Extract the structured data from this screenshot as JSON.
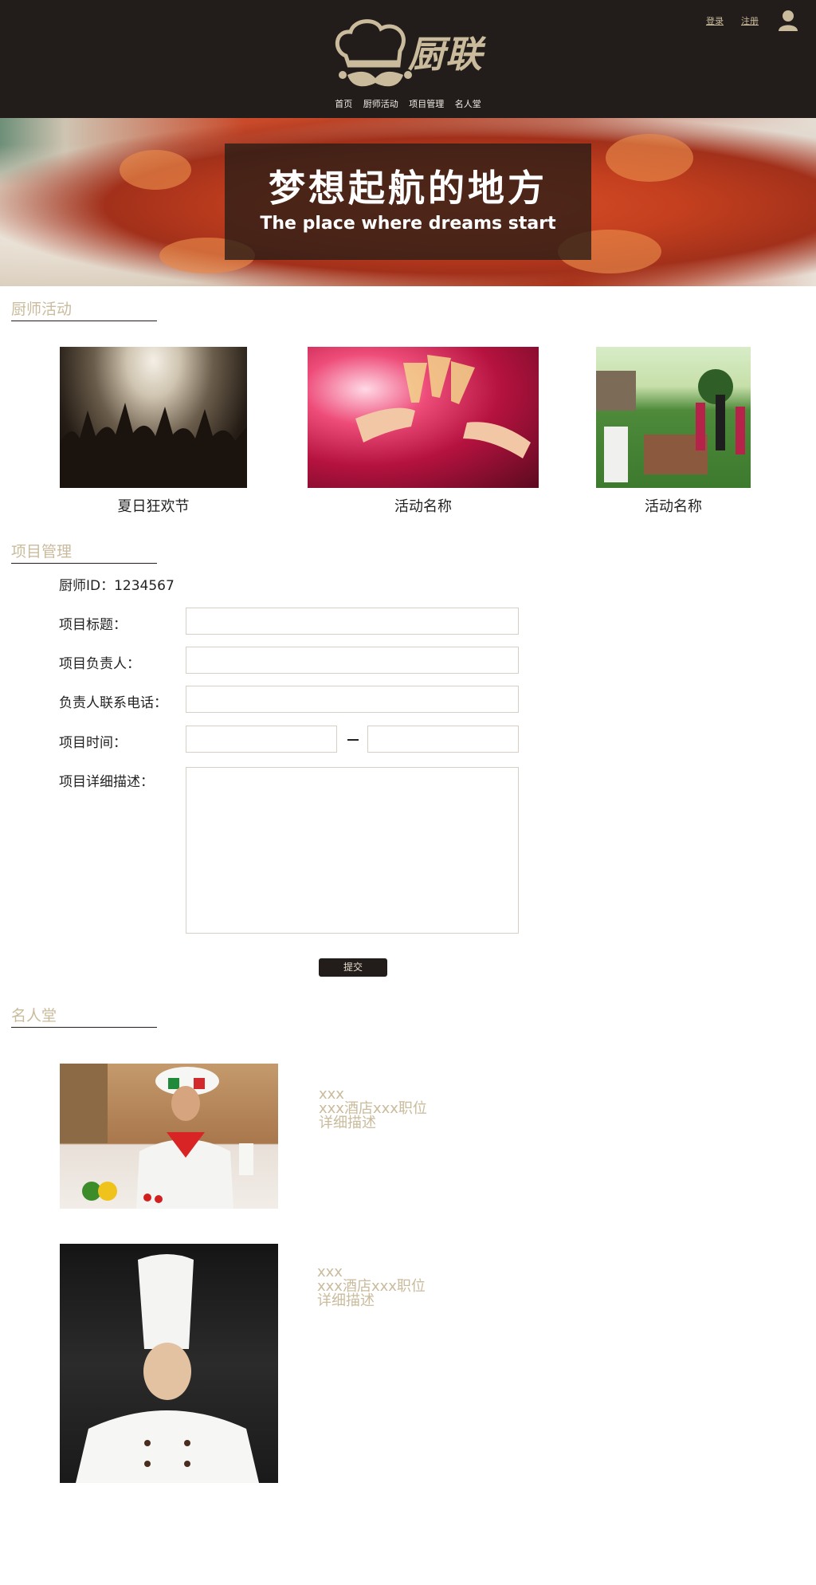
{
  "header": {
    "brand": "厨联",
    "nav": [
      "首页",
      "厨师活动",
      "项目管理",
      "名人堂"
    ],
    "login": "登录",
    "register": "注册"
  },
  "banner": {
    "title_cn": "梦想起航的地方",
    "title_en": "The place where dreams start"
  },
  "activities": {
    "section_title": "厨师活动",
    "items": [
      {
        "caption": "夏日狂欢节"
      },
      {
        "caption": "活动名称"
      },
      {
        "caption": "活动名称"
      }
    ]
  },
  "project": {
    "section_title": "项目管理",
    "chef_id": "厨师ID：1234567",
    "fields": {
      "title_label": "项目标题：",
      "owner_label": "项目负责人：",
      "phone_label": "负责人联系电话：",
      "time_label": "项目时间：",
      "desc_label": "项目详细描述："
    },
    "submit": "提交"
  },
  "hall": {
    "section_title": "名人堂",
    "chefs": [
      {
        "name": "xxx",
        "position": "xxx酒店xxx职位",
        "desc": "详细描述"
      },
      {
        "name": "xxx",
        "position": "xxx酒店xxx职位",
        "desc": "详细描述"
      }
    ]
  },
  "colors": {
    "header_bg": "#221d1b",
    "accent": "#c9bb9c"
  },
  "icons": [
    "chef-logo-icon",
    "user-icon"
  ]
}
